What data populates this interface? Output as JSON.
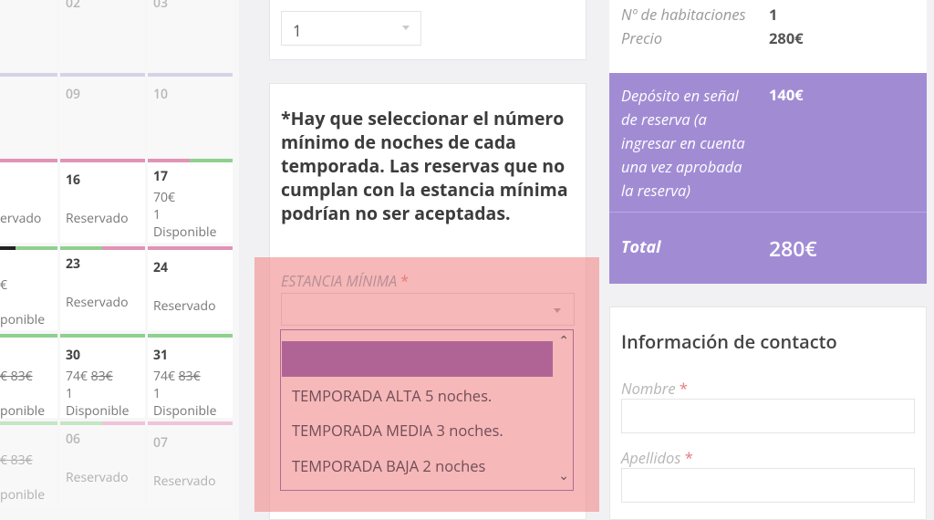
{
  "calendar": {
    "top_day_a": "02",
    "top_day_b": "03",
    "row1": {
      "a_day": "09",
      "b_day": "10"
    },
    "row2": {
      "left_status": "ervado",
      "a_day": "16",
      "a_status": "Reservado",
      "b_day": "17",
      "b_price": "70€",
      "b_count": "1",
      "b_status": "Disponible"
    },
    "row3": {
      "left_price": "€",
      "left_status": "ponible",
      "a_day": "23",
      "a_status": "Reservado",
      "b_day": "24",
      "b_status": "Reservado"
    },
    "row4": {
      "left_price": "€ 83€",
      "left_status": "ponible",
      "a_day": "30",
      "a_price": "74€",
      "a_old": "83€",
      "a_count": "1",
      "a_status": "Disponible",
      "b_day": "31",
      "b_price": "74€",
      "b_old": "83€",
      "b_count": "1",
      "b_status": "Disponible"
    },
    "row5": {
      "left_price": "€ 83€",
      "left_status": "ponible",
      "a_day": "06",
      "a_status": "Reservado",
      "b_day": "07",
      "b_status": "Reservado"
    }
  },
  "middle": {
    "top_select_value": "1",
    "notice": "*Hay que seleccionar el número mínimo de noches de cada temporada. Las reservas que no cumplan con la estancia mínima podrían no ser aceptadas.",
    "estancia_label": "ESTANCIA MÍNIMA",
    "required_mark": "*",
    "options": [
      "TEMPORADA ALTA 5 noches.",
      "TEMPORADA MEDIA 3 noches.",
      "TEMPORADA BAJA 2 noches"
    ]
  },
  "summary": {
    "rooms_label": "Nº de habitaciones",
    "rooms_value": "1",
    "price_label": "Precio",
    "price_value": "280€",
    "deposit_label": "Depósito en señal de reserva (a ingresar en cuenta una vez aprobada la reserva)",
    "deposit_value": "140€",
    "total_label": "Total",
    "total_value": "280€"
  },
  "contact": {
    "title": "Información de contacto",
    "name_label": "Nombre",
    "surname_label": "Apellidos",
    "required_mark": "*"
  },
  "colors": {
    "accent_purple": "#a18cd4",
    "available": "#8fd08f",
    "reserved": "#e193b6",
    "highlight": "#f08c8c"
  }
}
